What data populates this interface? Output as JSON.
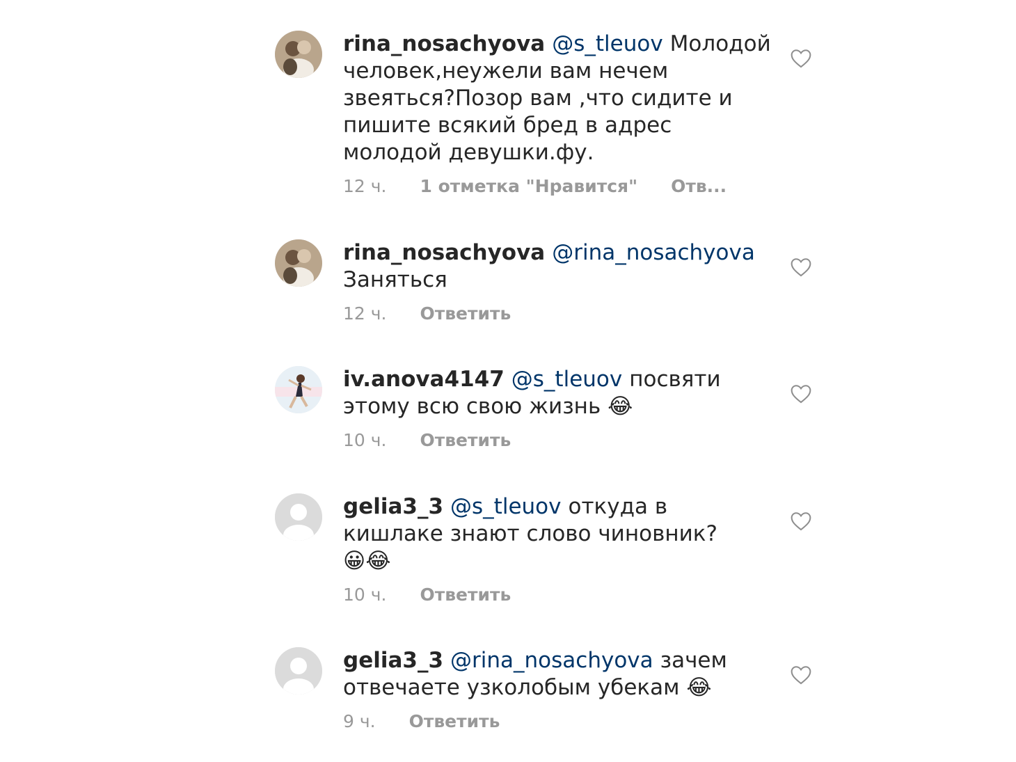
{
  "comments": [
    {
      "username": "rina_nosachyova",
      "mention": "@s_tleuov",
      "text": "Молодой человек,неужели вам нечем звеяться?Позор вам ,что сидите и пишите всякий бред в адрес молодой девушки.фу.",
      "emoji": "",
      "time": "12 ч.",
      "likes": "1 отметка \"Нравится\"",
      "reply": "Отв...",
      "avatar": "photo-couple"
    },
    {
      "username": "rina_nosachyova",
      "mention": "@rina_nosachyova",
      "text": "Заняться",
      "emoji": "",
      "time": "12 ч.",
      "likes": "",
      "reply": "Ответить",
      "avatar": "photo-couple"
    },
    {
      "username": "iv.anova4147",
      "mention": "@s_tleuov",
      "text": "посвяти этому всю свою жизнь",
      "emoji": "😂",
      "time": "10 ч.",
      "likes": "",
      "reply": "Ответить",
      "avatar": "photo-skater"
    },
    {
      "username": "gelia3_3",
      "mention": "@s_tleuov",
      "text": "откуда в кишлаке знают слово чиновник?",
      "emoji": "😀😂",
      "time": "10 ч.",
      "likes": "",
      "reply": "Ответить",
      "avatar": "default-user"
    },
    {
      "username": "gelia3_3",
      "mention": "@rina_nosachyova",
      "text": "зачем отвечаете узколобым убекам",
      "emoji": "😂",
      "time": "9 ч.",
      "likes": "",
      "reply": "Ответить",
      "avatar": "default-user"
    }
  ],
  "icons": {
    "like": "heart-outline-icon"
  },
  "colors": {
    "mention": "#003569",
    "meta": "#999999",
    "text": "#262626"
  }
}
